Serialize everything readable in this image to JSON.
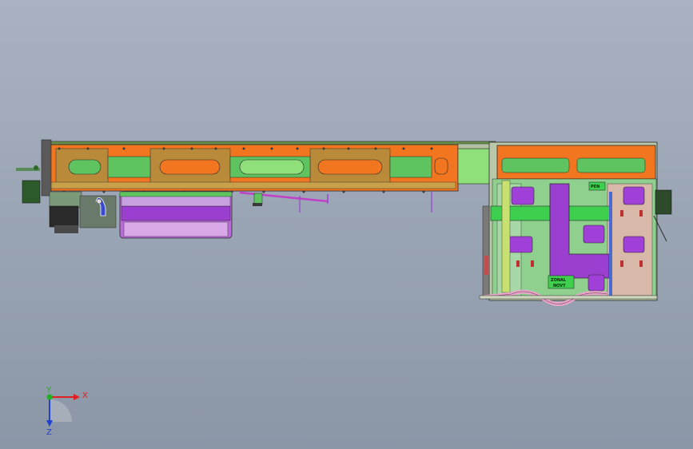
{
  "viewport": {
    "background_top": "#a9b2c0",
    "background_bottom": "#8b96a7"
  },
  "colors": {
    "orange": "#f2761f",
    "green": "#5fc35f",
    "light_green": "#8fe07a",
    "purple": "#9b3fd0",
    "magenta": "#c040c8",
    "pink": "#e8a6c8",
    "dark_green": "#2d6a2a",
    "yellow": "#d9d64a",
    "outline": "#2a2a2a"
  },
  "component_tags": {
    "upper": "PEN",
    "lower_line1": "ZONAL",
    "lower_line2": "NOVT"
  },
  "triad": {
    "x_label": "X",
    "y_label": "Y",
    "z_label": "Z",
    "x_color": "#e02020",
    "y_color": "#20b020",
    "z_color": "#2040d0"
  }
}
